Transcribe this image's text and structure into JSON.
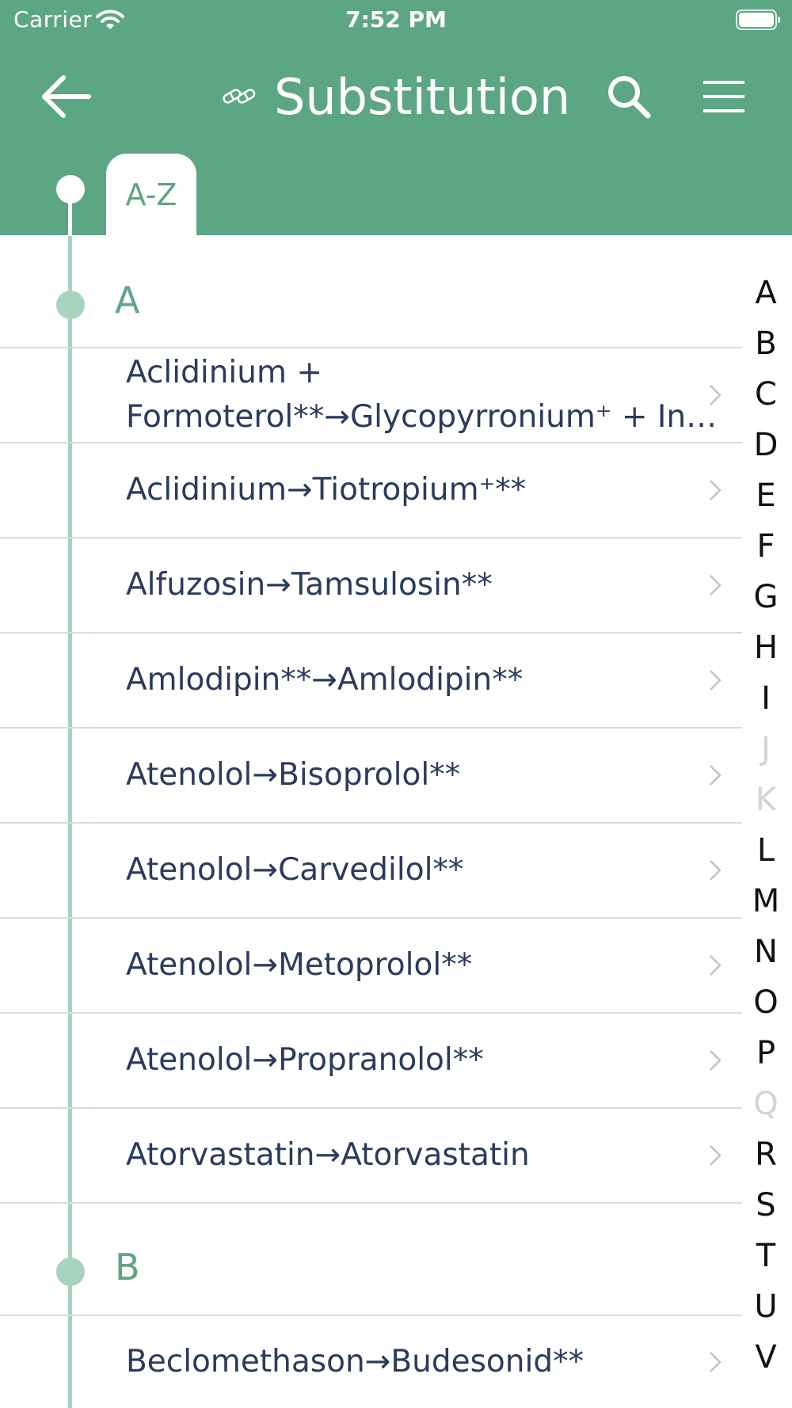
{
  "status_bar": {
    "carrier": "Carrier",
    "time": "7:52 PM"
  },
  "nav": {
    "title": "Substitution",
    "back_icon": "arrow-left-icon",
    "title_icon": "pills-icon",
    "search_icon": "search-icon",
    "menu_icon": "hamburger-menu-icon"
  },
  "tabs": [
    {
      "label": "A-Z",
      "selected": true
    }
  ],
  "sections": [
    {
      "letter": "A",
      "items": [
        {
          "lines": [
            "Aclidinium +",
            "Formoterol**→Glycopyrronium⁺ + Ind..."
          ]
        },
        {
          "label": "Aclidinium→Tiotropium⁺**"
        },
        {
          "label": "Alfuzosin→Tamsulosin**"
        },
        {
          "label": "Amlodipin**→Amlodipin**"
        },
        {
          "label": "Atenolol→Bisoprolol**"
        },
        {
          "label": "Atenolol→Carvedilol**"
        },
        {
          "label": "Atenolol→Metoprolol**"
        },
        {
          "label": "Atenolol→Propranolol**"
        },
        {
          "label": "Atorvastatin→Atorvastatin"
        }
      ]
    },
    {
      "letter": "B",
      "items": [
        {
          "label": "Beclomethason→Budesonid**"
        }
      ]
    }
  ],
  "index_letters": [
    {
      "letter": "A",
      "enabled": true
    },
    {
      "letter": "B",
      "enabled": true
    },
    {
      "letter": "C",
      "enabled": true
    },
    {
      "letter": "D",
      "enabled": true
    },
    {
      "letter": "E",
      "enabled": true
    },
    {
      "letter": "F",
      "enabled": true
    },
    {
      "letter": "G",
      "enabled": true
    },
    {
      "letter": "H",
      "enabled": true
    },
    {
      "letter": "I",
      "enabled": true
    },
    {
      "letter": "J",
      "enabled": false
    },
    {
      "letter": "K",
      "enabled": false
    },
    {
      "letter": "L",
      "enabled": true
    },
    {
      "letter": "M",
      "enabled": true
    },
    {
      "letter": "N",
      "enabled": true
    },
    {
      "letter": "O",
      "enabled": true
    },
    {
      "letter": "P",
      "enabled": true
    },
    {
      "letter": "Q",
      "enabled": false
    },
    {
      "letter": "R",
      "enabled": true
    },
    {
      "letter": "S",
      "enabled": true
    },
    {
      "letter": "T",
      "enabled": true
    },
    {
      "letter": "U",
      "enabled": true
    },
    {
      "letter": "V",
      "enabled": true
    }
  ],
  "colors": {
    "header": "#5da684",
    "accent": "#5da684",
    "timeline": "#a8d4bf",
    "item_text": "#2b3b5c",
    "divider": "#dcdcdc",
    "index_disabled": "#d4d4d4"
  }
}
